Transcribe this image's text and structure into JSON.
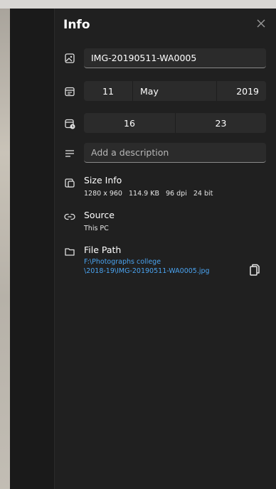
{
  "panel": {
    "title": "Info",
    "close_icon": "close-icon"
  },
  "file_name": {
    "icon": "image-icon",
    "value": "IMG-20190511-WA0005"
  },
  "date": {
    "icon": "calendar-icon",
    "day": "11",
    "month": "May",
    "year": "2019"
  },
  "time": {
    "icon": "clock-calendar-icon",
    "hour": "16",
    "minute": "23"
  },
  "description": {
    "icon": "text-lines-icon",
    "placeholder": "Add a description"
  },
  "size_info": {
    "icon": "size-info-icon",
    "label": "Size Info",
    "dimensions": "1280 x 960",
    "file_size": "114.9 KB",
    "dpi": "96 dpi",
    "bit_depth": "24 bit"
  },
  "source": {
    "icon": "link-icon",
    "label": "Source",
    "value": "This PC"
  },
  "file_path": {
    "icon": "folder-icon",
    "label": "File Path",
    "line1": "F:\\Photographs college",
    "line2": "\\2018-19\\IMG-20190511-WA0005.jpg",
    "copy_icon": "copy-icon"
  },
  "colors": {
    "accent_link": "#4aa3f0",
    "panel_bg": "#202020",
    "field_bg": "#2b2b2b"
  }
}
